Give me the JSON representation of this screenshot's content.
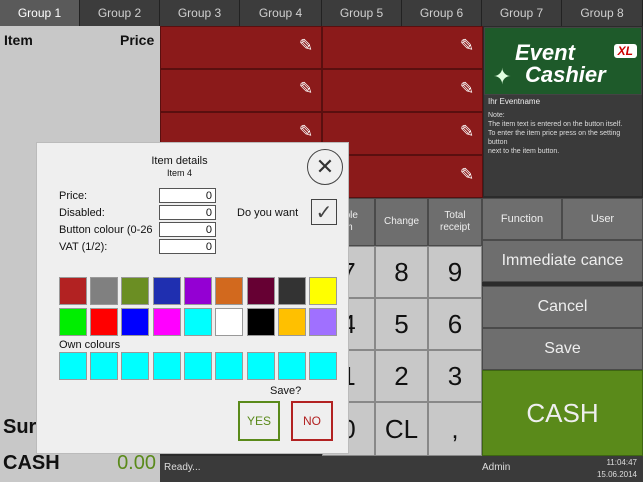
{
  "tabs": [
    "Group 1",
    "Group 2",
    "Group 3",
    "Group 4",
    "Group 5",
    "Group 6",
    "Group 7",
    "Group 8"
  ],
  "receipt": {
    "col_item": "Item",
    "col_price": "Price",
    "sum_label": "Sur",
    "cash_label": "CASH",
    "cash_value": "0.00"
  },
  "logo": {
    "line1": "Event",
    "line2": "Cashier",
    "badge": "XL"
  },
  "event_name": "Ihr Eventname",
  "note": {
    "title": "Note:",
    "line1": "The item text is entered on the button itself.",
    "line2": "To enter the item price press on the setting button",
    "line3": "next to the item button."
  },
  "func": {
    "function": "Function",
    "user": "User",
    "immediate": "Immediate cance",
    "cancel": "Cancel",
    "save": "Save",
    "cash": "CASH"
  },
  "numpad_top": {
    "able": "able",
    "m": "m",
    "change": "Change",
    "total": "Total",
    "total2": "receipt"
  },
  "keys": {
    "k7": "7",
    "k8": "8",
    "k9": "9",
    "k4": "4",
    "k5": "5",
    "k6": "6",
    "k1": "1",
    "k2": "2",
    "k3": "3",
    "k0": "0",
    "cl": "CL",
    "comma": ","
  },
  "status": {
    "ready": "Ready...",
    "user": "Admin",
    "time": "11:04:47",
    "date": "15.06.2014"
  },
  "dialog": {
    "title": "Item details",
    "subtitle": "Item 4",
    "price_label": "Price:",
    "price_value": "0",
    "disabled_label": "Disabled:",
    "disabled_value": "0",
    "colour_label": "Button colour (0-26",
    "colour_value": "0",
    "vat_label": "VAT (1/2):",
    "vat_value": "0",
    "question": "Do you want",
    "own_colours": "Own colours",
    "save_q": "Save?",
    "yes": "YES",
    "no": "NO"
  },
  "palette_row1": [
    "#b22222",
    "#808080",
    "#6b8e23",
    "#1f2fb0",
    "#9400d3",
    "#d2691e",
    "#660033",
    "#333333",
    "#ffff00"
  ],
  "palette_row2": [
    "#00ee00",
    "#ff0000",
    "#0000ff",
    "#ff00ff",
    "#00ffff",
    "#ffffff",
    "#000000",
    "#ffc000",
    "#a070ff"
  ],
  "own_palette": [
    "#00ffff",
    "#00ffff",
    "#00ffff",
    "#00ffff",
    "#00ffff",
    "#00ffff",
    "#00ffff",
    "#00ffff",
    "#00ffff"
  ]
}
